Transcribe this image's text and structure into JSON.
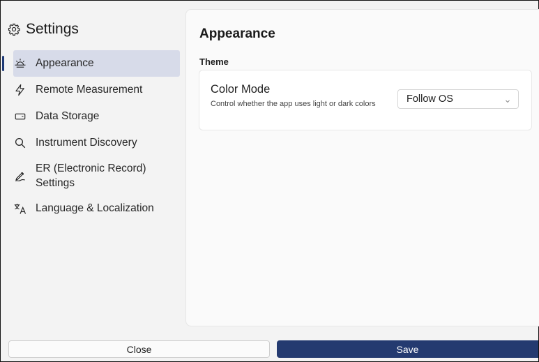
{
  "sidebar": {
    "title": "Settings",
    "icon": "gear-icon",
    "items": [
      {
        "label": "Appearance",
        "icon": "sunrise-icon",
        "active": true
      },
      {
        "label": "Remote Measurement",
        "icon": "lightning-icon",
        "active": false
      },
      {
        "label": "Data Storage",
        "icon": "storage-drive-icon",
        "active": false
      },
      {
        "label": "Instrument Discovery",
        "icon": "search-icon",
        "active": false
      },
      {
        "label": "ER (Electronic Record) Settings",
        "icon": "signature-pen-icon",
        "active": false
      },
      {
        "label": "Language & Localization",
        "icon": "translate-icon",
        "active": false
      }
    ]
  },
  "main": {
    "title": "Appearance",
    "section_title": "Theme",
    "setting": {
      "title": "Color Mode",
      "description": "Control whether the app uses light or dark colors",
      "select_value": "Follow OS"
    }
  },
  "footer": {
    "close_label": "Close",
    "save_label": "Save"
  },
  "colors": {
    "accent": "#243a70",
    "active_item_bg": "#d7dbe9",
    "sidebar_bg": "#f3f3f3",
    "content_bg": "#fafafa"
  }
}
